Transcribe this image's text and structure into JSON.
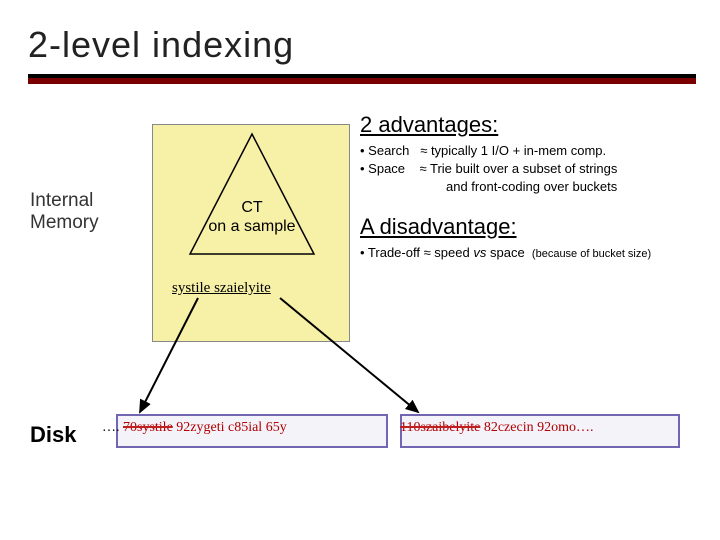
{
  "title": "2-level indexing",
  "left": {
    "internal_memory": "Internal Memory",
    "ct_line1": "CT",
    "ct_line2": "on a sample",
    "sample_words": "systile szaielyite",
    "disk": "Disk"
  },
  "right": {
    "advantages_title": "2 advantages:",
    "adv1_label": "• Search",
    "adv1_text": "≈ typically 1 I/O + in-mem comp.",
    "adv2_label": "• Space",
    "adv2_text": "≈ Trie built over a subset of strings",
    "adv2_cont": "and front-coding over buckets",
    "disadvantage_title": "A disadvantage:",
    "dis_bullet": "• Trade-off ≈ speed",
    "dis_vs": "vs",
    "dis_space": "space",
    "dis_note": "(because of bucket size)"
  },
  "buckets": {
    "b1_prefix": "….",
    "b1_strike1": "70systile",
    "b1_mid": " 92zygeti c85ial 65y",
    "b2_strike": "110szaibelyite",
    "b2_rest": " 82czecin 92omo…."
  }
}
